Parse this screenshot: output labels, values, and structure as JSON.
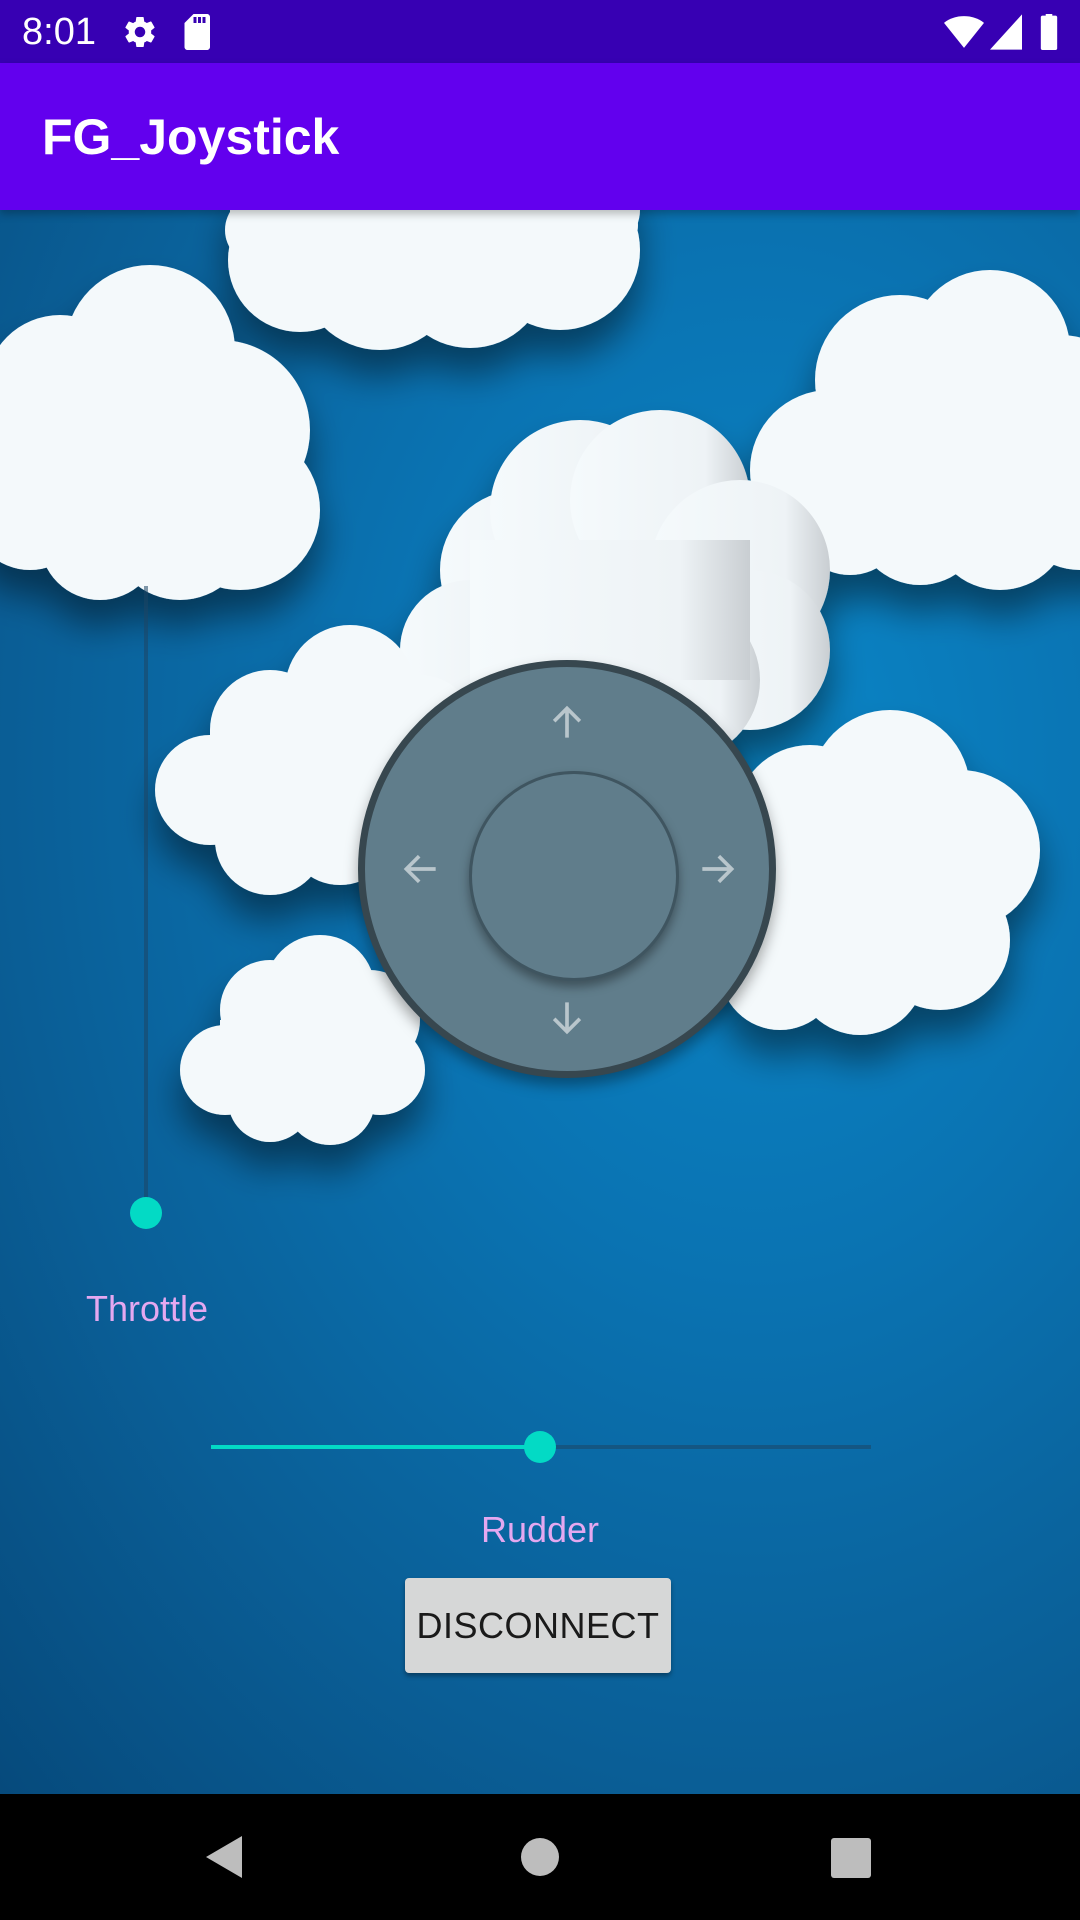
{
  "status_bar": {
    "time": "8:01",
    "icons": [
      "settings-icon",
      "sd-card-icon",
      "wifi-icon",
      "signal-icon",
      "battery-icon"
    ]
  },
  "app_bar": {
    "title": "FG_Joystick",
    "color": "#6200EE",
    "status_color": "#3700B3"
  },
  "controls": {
    "throttle": {
      "label": "Throttle",
      "value_fraction": 0.0
    },
    "rudder": {
      "label": "Rudder",
      "value_fraction": 0.5
    },
    "joystick": {
      "arrows": [
        "arrow-up-icon",
        "arrow-left-icon",
        "arrow-right-icon",
        "arrow-down-icon"
      ]
    },
    "accent_color": "#03DAC5",
    "label_color": "#E4A8F0"
  },
  "buttons": {
    "disconnect_label": "DISCONNECT"
  },
  "nav_bar": {
    "icons": [
      "back-icon",
      "home-icon",
      "recents-icon"
    ]
  }
}
